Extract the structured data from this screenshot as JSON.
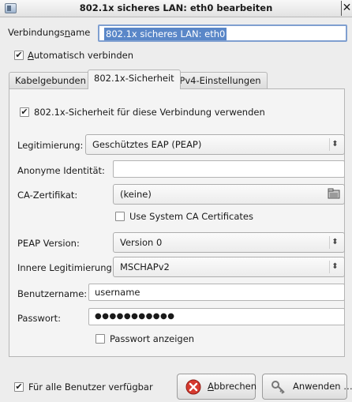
{
  "window": {
    "title": "802.1x sicheres LAN: eth0 bearbeiten",
    "close_glyph": "✕"
  },
  "connection_name": {
    "label_pre": "Verbindungs",
    "label_ul": "n",
    "label_post": "ame",
    "value": "802.1x sicheres LAN: eth0"
  },
  "auto_connect": {
    "label_ul": "A",
    "label_rest": "utomatisch verbinden",
    "checked": true
  },
  "tabs": [
    {
      "label": "Kabelgebunden",
      "active": false
    },
    {
      "label": "802.1x-Sicherheit",
      "active": true
    },
    {
      "label": "IPv4-Einstellungen",
      "active": false
    }
  ],
  "security": {
    "use_8021x": {
      "label": "802.1x-Sicherheit für diese Verbindung verwenden",
      "checked": true
    },
    "auth": {
      "label": "Legitimierung:",
      "value": "Geschütztes EAP (PEAP)"
    },
    "anon_identity": {
      "label": "Anonyme Identität:",
      "value": ""
    },
    "ca_cert": {
      "label": "CA-Zertifikat:",
      "value": "(keine)"
    },
    "system_ca": {
      "label": "Use System CA Certificates",
      "checked": false
    },
    "peap_version": {
      "label": "PEAP Version:",
      "value": "Version 0"
    },
    "inner_auth": {
      "label": "Innere Legitimierung:",
      "value": "MSCHAPv2"
    },
    "username": {
      "label": "Benutzername:",
      "value": "username"
    },
    "password": {
      "label": "Passwort:",
      "value": "●●●●●●●●●●●"
    },
    "show_password": {
      "label": "Passwort anzeigen",
      "checked": false
    }
  },
  "footer": {
    "all_users": {
      "label": "Für alle Benutzer verfügbar",
      "checked": true
    },
    "cancel": {
      "label_ul": "A",
      "label_rest": "bbrechen"
    },
    "apply": {
      "label": "Anwenden …"
    }
  },
  "icons": {
    "app": "network-connection-icon",
    "combo": "up-down-arrow-icon",
    "file": "open-file-icon",
    "cancel": "cancel-icon",
    "apply": "keys-icon"
  },
  "check_glyph": "✔",
  "combo_glyph": "⬍"
}
